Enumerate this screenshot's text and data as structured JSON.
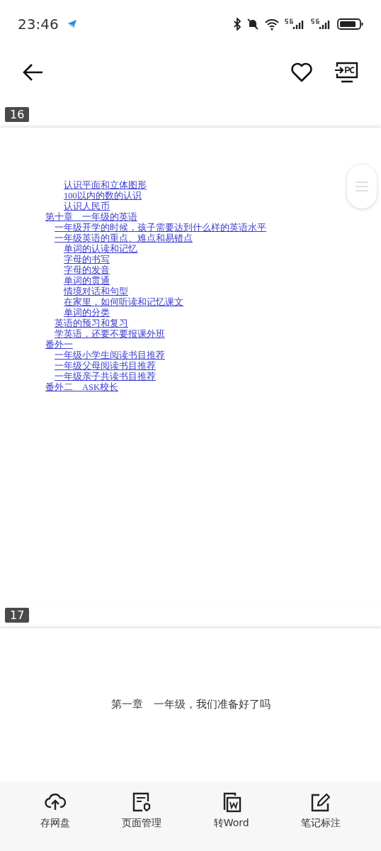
{
  "status_bar": {
    "time": "23:46"
  },
  "pages": [
    {
      "number": "16",
      "toc": [
        {
          "children": [
            {
              "children": [
                {
                  "title": "认识平面和立体图形"
                },
                {
                  "title": "100以内的数的认识"
                },
                {
                  "title": "认识人民币"
                }
              ]
            }
          ]
        },
        {
          "title": "第十章　一年级的英语",
          "children": [
            {
              "title": "一年级开学的时候，孩子需要达到什么样的英语水平"
            },
            {
              "title": "一年级英语的重点、难点和易错点",
              "children": [
                {
                  "title": "单词的认读和记忆"
                },
                {
                  "title": "字母的书写"
                },
                {
                  "title": "字母的发音"
                },
                {
                  "title": "单词的贯通"
                },
                {
                  "title": "情境对话和句型"
                },
                {
                  "title": "在家里，如何听读和记忆课文"
                },
                {
                  "title": "单词的分类"
                }
              ]
            },
            {
              "title": "英语的预习和复习"
            },
            {
              "title": "学英语，还要不要报课外班"
            }
          ]
        },
        {
          "title": "番外一",
          "children": [
            {
              "title": "一年级小学生阅读书目推荐"
            },
            {
              "title": "一年级父母阅读书目推荐"
            },
            {
              "title": "一年级亲子共读书目推荐"
            }
          ]
        },
        {
          "title": "番外二　ASK校长"
        }
      ]
    },
    {
      "number": "17",
      "heading": "第一章　一年级，我们准备好了吗"
    }
  ],
  "bottom_bar": [
    {
      "label": "存网盘",
      "kind": "cloud"
    },
    {
      "label": "页面管理",
      "kind": "pages"
    },
    {
      "label": "转Word",
      "kind": "word"
    },
    {
      "label": "笔记标注",
      "kind": "note"
    }
  ]
}
